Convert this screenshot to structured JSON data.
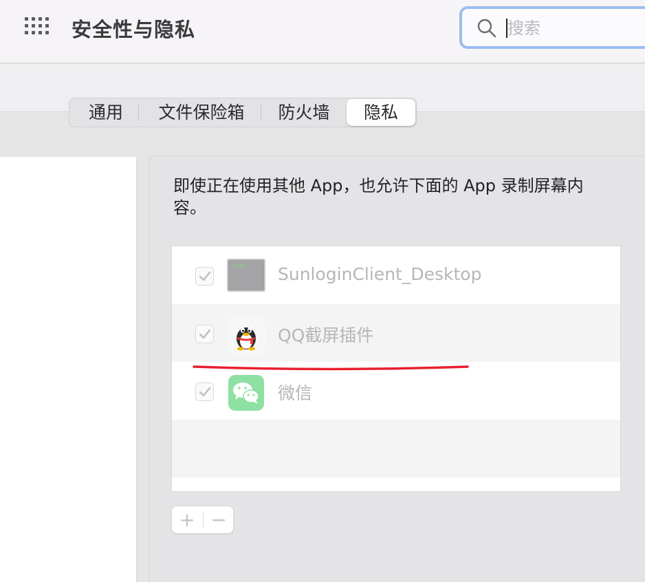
{
  "window": {
    "title": "安全性与隐私",
    "grid_icon": "show-all-grid-icon"
  },
  "search": {
    "placeholder": "搜索",
    "value": "",
    "icon": "magnifier-icon"
  },
  "tabs": [
    {
      "label": "通用",
      "active": false
    },
    {
      "label": "文件保险箱",
      "active": false
    },
    {
      "label": "防火墙",
      "active": false
    },
    {
      "label": "隐私",
      "active": true
    }
  ],
  "privacy": {
    "description": "即使正在使用其他 App，也允许下面的 App 录制屏幕内容。",
    "apps": [
      {
        "name": "SunloginClient_Desktop",
        "checked": true,
        "icon": "exec-terminal-icon",
        "icon_text": "exec"
      },
      {
        "name": "QQ截屏插件",
        "checked": true,
        "icon": "qq-penguin-icon"
      },
      {
        "name": "微信",
        "checked": true,
        "icon": "wechat-icon"
      }
    ],
    "add_label": "+",
    "remove_label": "−"
  },
  "colors": {
    "accent_focus": "#9bbcef",
    "annotation_red": "#e8202e",
    "wechat_green": "#8ee0a3"
  }
}
